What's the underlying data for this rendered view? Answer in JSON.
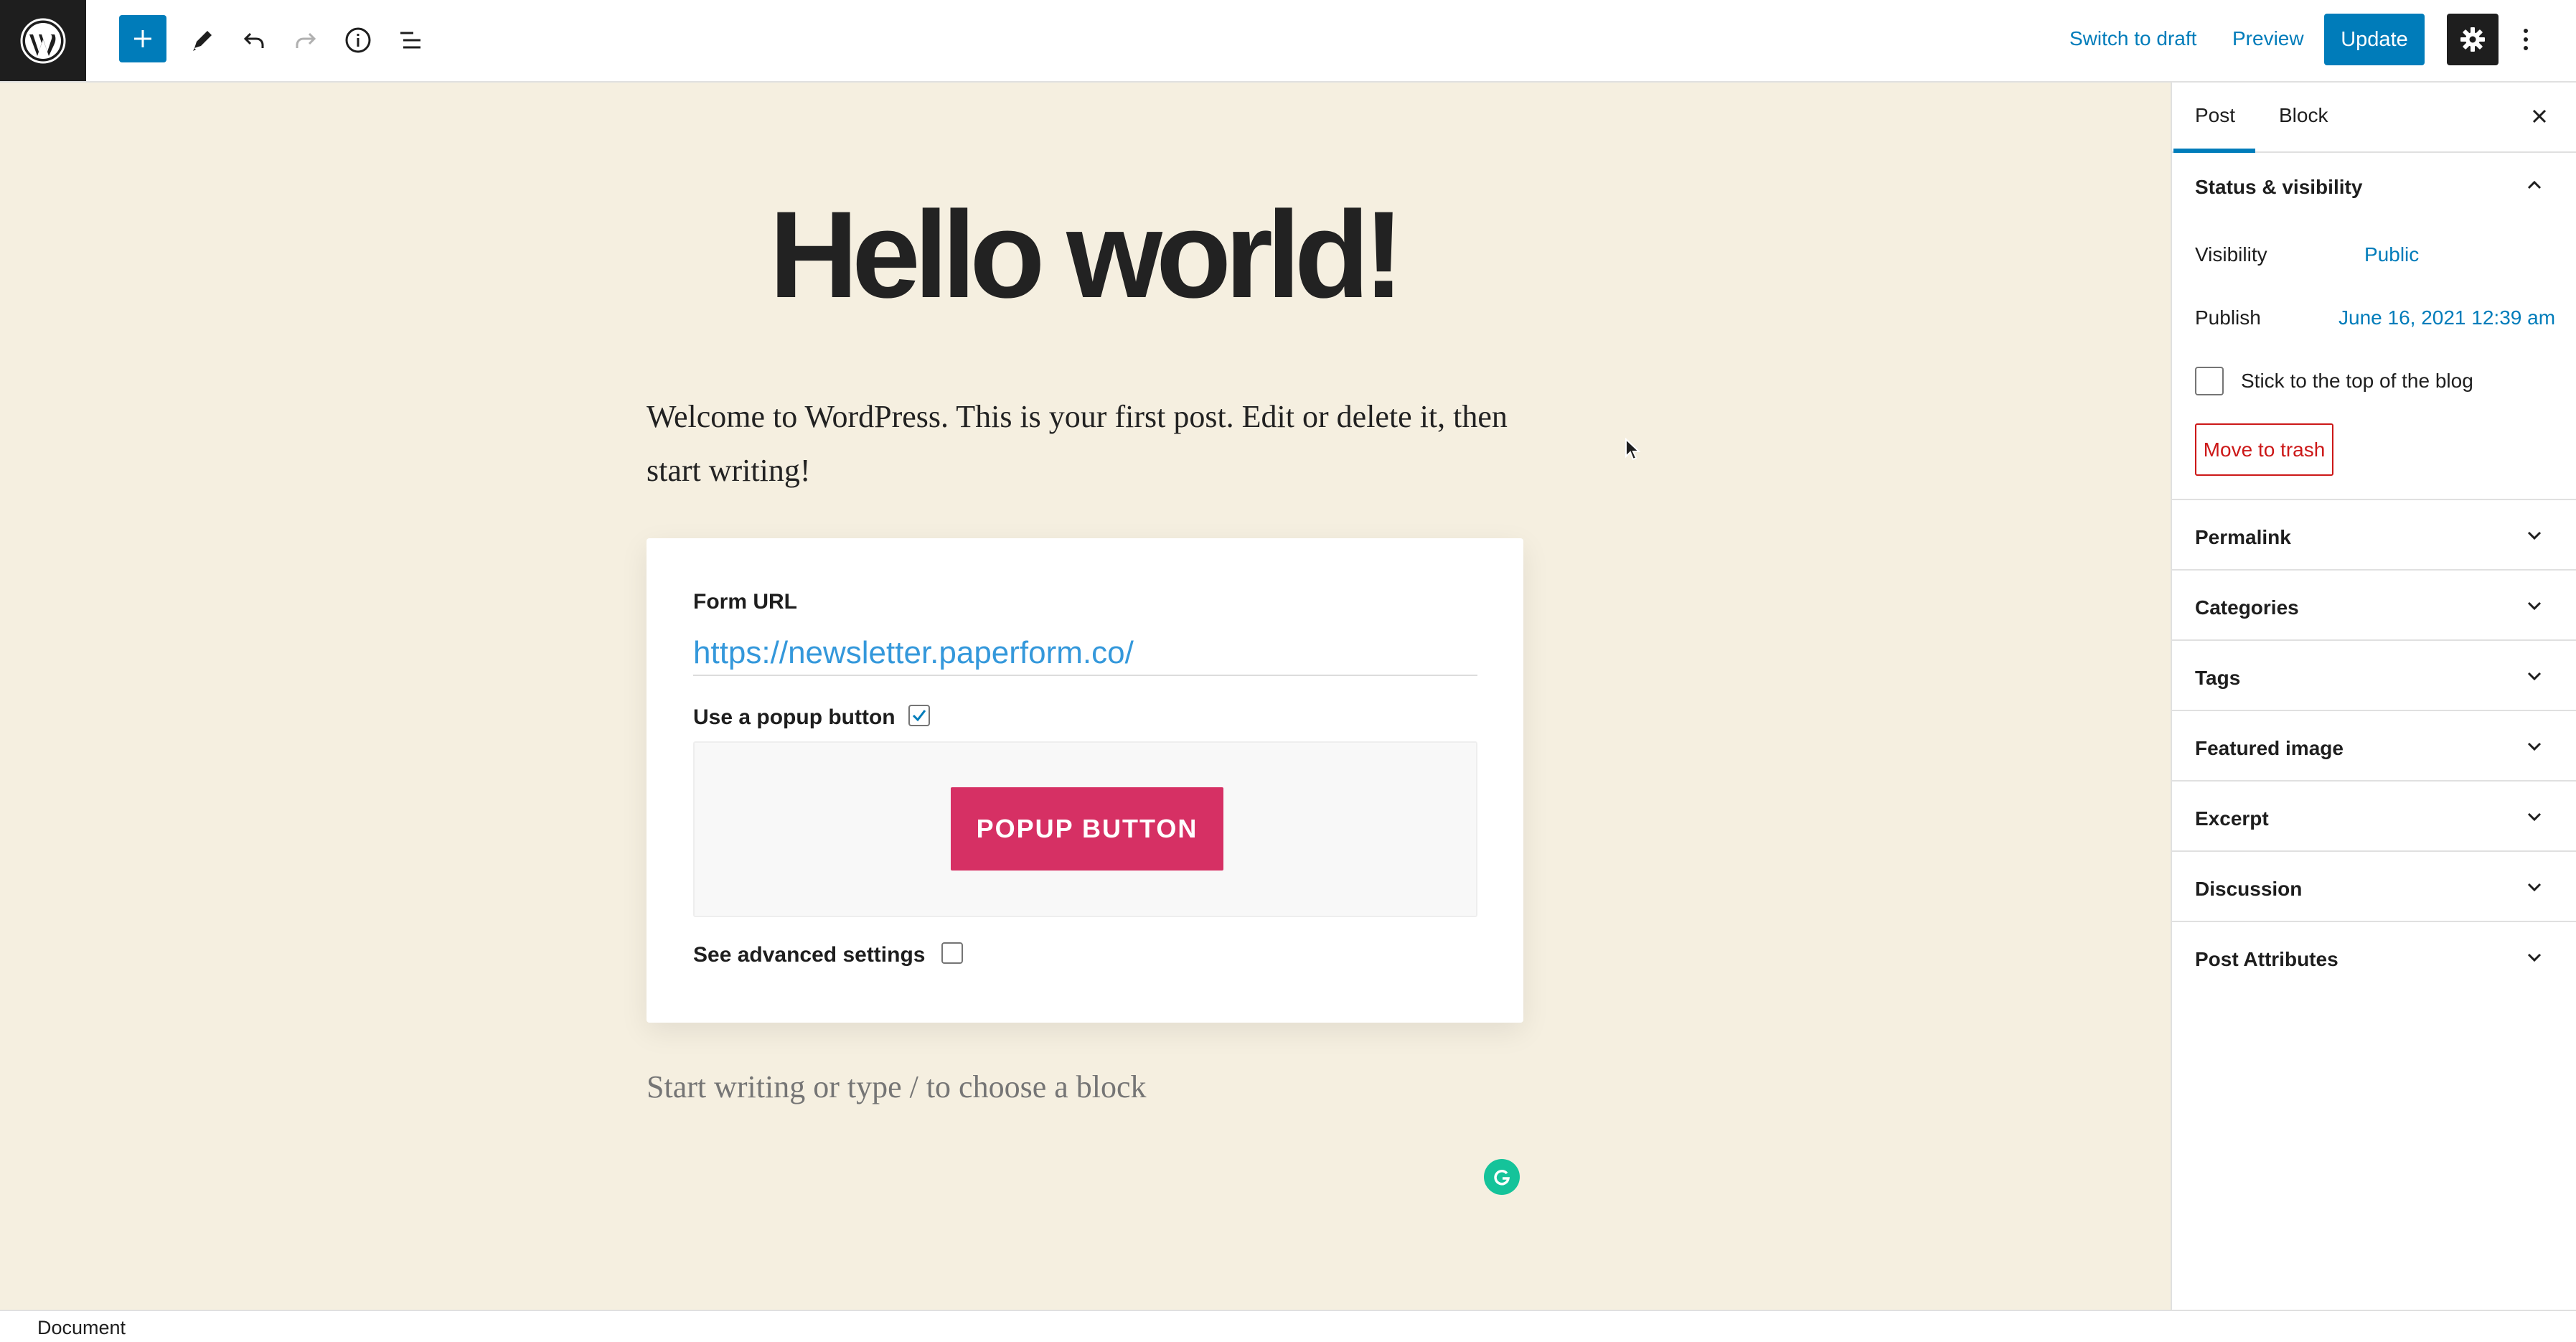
{
  "toolbar": {
    "logo_icon": "wordpress-logo",
    "add_icon": "plus-icon",
    "tools_icon": "pencil-icon",
    "undo_icon": "undo-icon",
    "redo_icon": "redo-icon",
    "details_icon": "info-icon",
    "outline_icon": "list-view-icon",
    "switch_to_draft": "Switch to draft",
    "preview": "Preview",
    "update": "Update",
    "settings_icon": "gear-icon",
    "more_icon": "vertical-ellipsis-icon",
    "accent_color": "#007cba"
  },
  "editor": {
    "background_color": "#f5efe0",
    "title": "Hello world!",
    "paragraph_line1": "Welcome to WordPress. This is your first post. Edit or delete it, then",
    "paragraph_line2": "start writing!",
    "form_block": {
      "url_label": "Form URL",
      "url_value": "https://newsletter.paperform.co/",
      "popup_label": "Use a popup button",
      "popup_checked": true,
      "popup_button_label": "POPUP BUTTON",
      "popup_button_color": "#d63064",
      "advanced_label": "See advanced settings",
      "advanced_checked": false
    },
    "placeholder": "Start writing or type / to choose a block",
    "grammarly_icon": "grammarly-icon"
  },
  "sidebar": {
    "tabs": [
      "Post",
      "Block"
    ],
    "active_tab": "Post",
    "close_icon": "close-icon",
    "status_panel": {
      "title": "Status & visibility",
      "visibility_label": "Visibility",
      "visibility_value": "Public",
      "publish_label": "Publish",
      "publish_value": "June 16, 2021 12:39 am",
      "sticky_label": "Stick to the top of the blog",
      "sticky_checked": false,
      "trash_label": "Move to trash"
    },
    "panels": [
      "Permalink",
      "Categories",
      "Tags",
      "Featured image",
      "Excerpt",
      "Discussion",
      "Post Attributes"
    ]
  },
  "footer": {
    "breadcrumb": "Document"
  }
}
